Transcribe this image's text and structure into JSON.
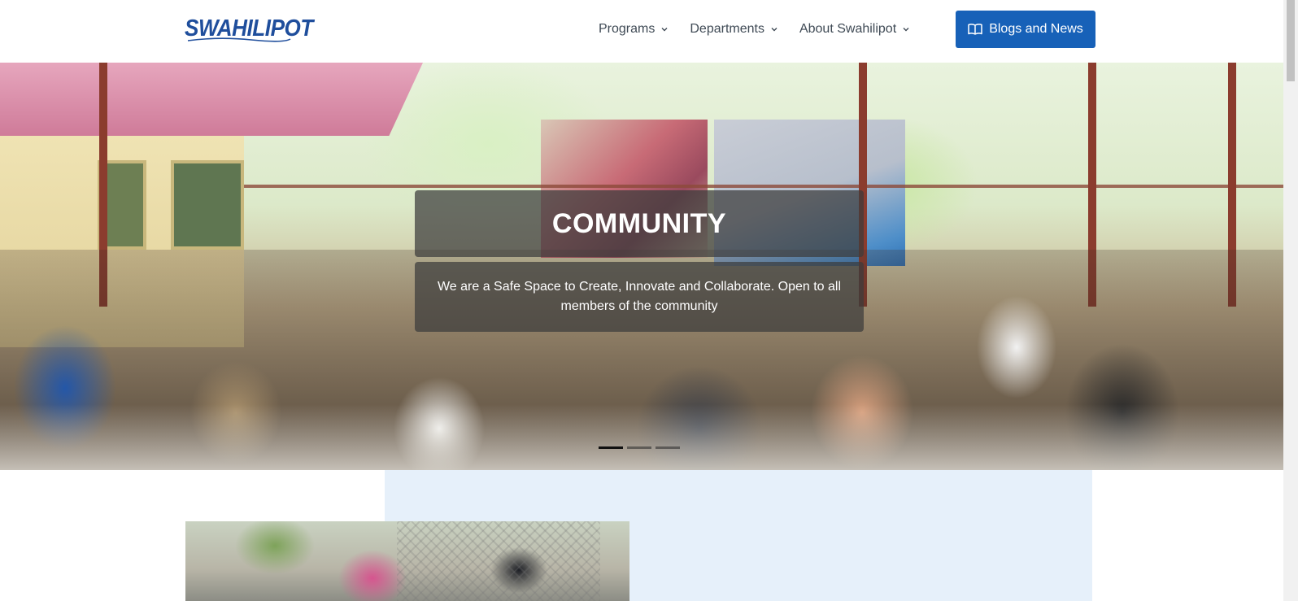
{
  "header": {
    "logo_text": "SWAHILIPOT",
    "nav": [
      {
        "label": "Programs"
      },
      {
        "label": "Departments"
      },
      {
        "label": "About Swahilipot"
      }
    ],
    "cta_label": "Blogs and News"
  },
  "hero": {
    "title": "COMMUNITY",
    "description": "We are a Safe Space to Create, Innovate and Collaborate. Open to all members of the community",
    "slides": 3,
    "active_slide": 1
  },
  "icons": {
    "nav_dropdown": "chevron-down-icon",
    "cta": "book-open-icon"
  },
  "colors": {
    "accent": "#1761b8",
    "logo": "#1f4e9c",
    "nav_text": "#3f4a55",
    "panel": "#e6f0fa"
  }
}
